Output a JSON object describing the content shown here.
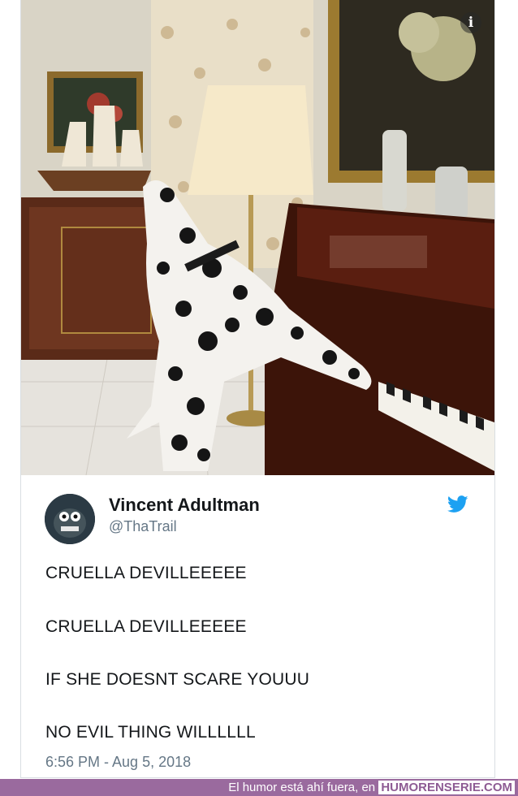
{
  "tweet": {
    "author": {
      "display_name": "Vincent Adultman",
      "handle": "@ThaTrail"
    },
    "lines": [
      "CRUELLA DEVILLEEEEE",
      "CRUELLA DEVILLEEEEE",
      "IF SHE DOESNT SCARE YOUUU",
      "NO EVIL THING WILLLLLL"
    ],
    "timestamp": "6:56 PM - Aug 5, 2018",
    "info_icon": "i"
  },
  "footer": {
    "text": "El humor está ahí fuera, en",
    "site": "HUMORENSERIE.COM"
  },
  "colors": {
    "twitter_blue": "#1da1f2",
    "footer_purple": "#9a6a9e"
  }
}
